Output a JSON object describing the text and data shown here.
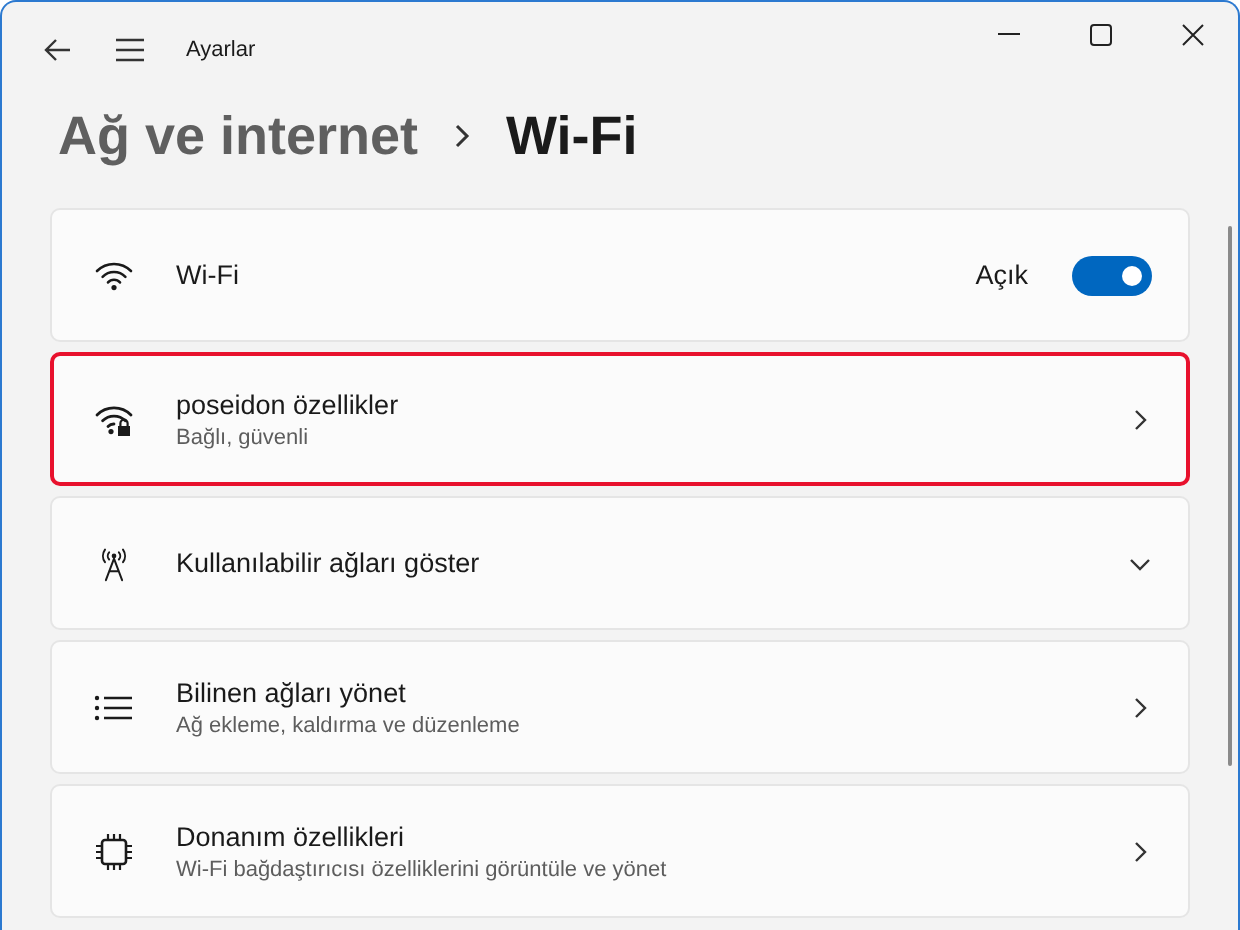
{
  "window": {
    "title": "Ayarlar"
  },
  "breadcrumb": {
    "parent": "Ağ ve internet",
    "current": "Wi-Fi"
  },
  "rows": [
    {
      "kind": "toggle",
      "title": "Wi-Fi",
      "state_label": "Açık",
      "on": true,
      "highlighted": false
    },
    {
      "kind": "link",
      "title": "poseidon özellikler",
      "subtitle": "Bağlı, güvenli",
      "highlighted": true
    },
    {
      "kind": "expand",
      "title": "Kullanılabilir ağları göster",
      "expanded": false,
      "highlighted": false
    },
    {
      "kind": "link",
      "title": "Bilinen ağları yönet",
      "subtitle": "Ağ ekleme, kaldırma ve düzenleme",
      "highlighted": false
    },
    {
      "kind": "link",
      "title": "Donanım özellikleri",
      "subtitle": "Wi-Fi bağdaştırıcısı özelliklerini görüntüle ve yönet",
      "highlighted": false
    }
  ]
}
